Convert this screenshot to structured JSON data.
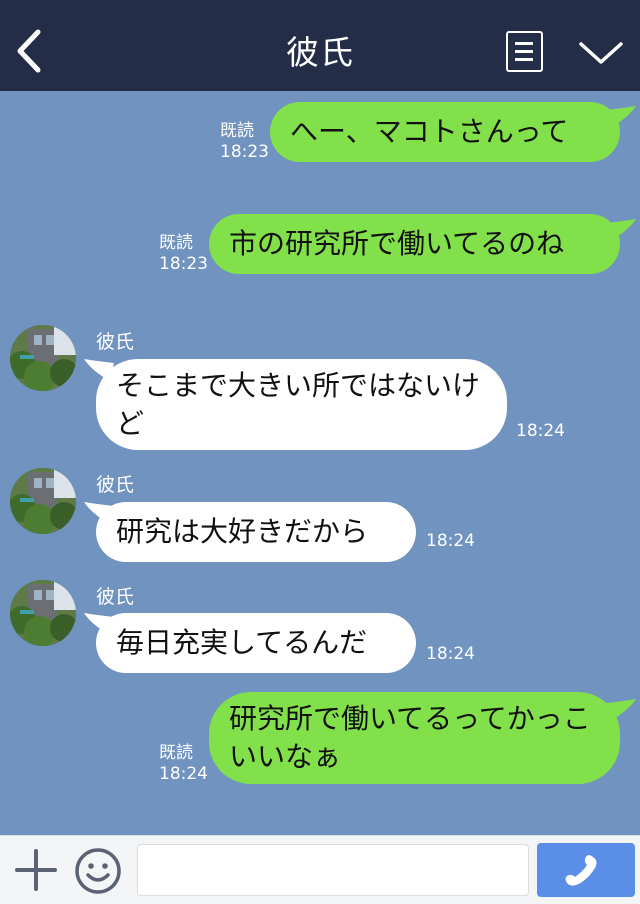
{
  "header": {
    "title": "彼氏",
    "back_icon": "back-chevron-icon",
    "menu_icon": "menu-list-icon",
    "dropdown_icon": "chevron-down-icon",
    "background_color": "#232d47"
  },
  "chat": {
    "background_color": "#7193c0",
    "my_bubble_color": "#82e04a",
    "their_bubble_color": "#ffffff",
    "messages": [
      {
        "from": "me",
        "text": "へー、マコトさんって",
        "read": "既読",
        "time": "18:23"
      },
      {
        "from": "me",
        "text": "市の研究所で働いてるのね",
        "read": "既読",
        "time": "18:23"
      },
      {
        "from": "them",
        "sender": "彼氏",
        "text": "そこまで大きい所ではないけど",
        "time": "18:24"
      },
      {
        "from": "them",
        "sender": "彼氏",
        "text": "研究は大好きだから",
        "time": "18:24"
      },
      {
        "from": "them",
        "sender": "彼氏",
        "text": "毎日充実してるんだ",
        "time": "18:24"
      },
      {
        "from": "me",
        "text": "研究所で働いてるってかっこいいなぁ",
        "read": "既読",
        "time": "18:24"
      }
    ]
  },
  "footer": {
    "plus_icon": "plus-icon",
    "emoji_icon": "smiley-icon",
    "input_value": "",
    "input_placeholder": "",
    "call_icon": "phone-icon",
    "call_button_color": "#5b8ee6"
  }
}
